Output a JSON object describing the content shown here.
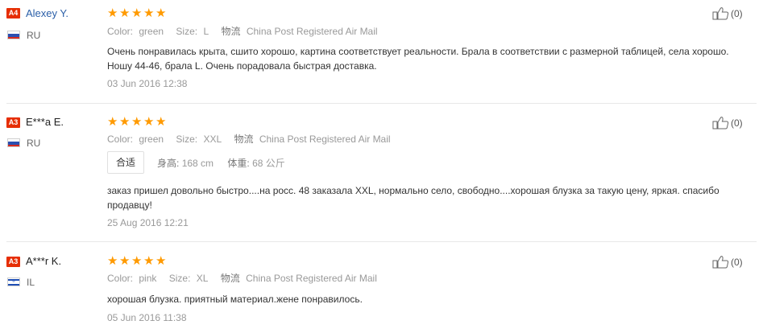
{
  "reviews": [
    {
      "level": "A4",
      "name": "Alexey Y.",
      "country": "RU",
      "stars": 5,
      "meta": {
        "color_label": "Color:",
        "color_value": "green",
        "size_label": "Size:",
        "size_value": "L",
        "ship_label": "物流",
        "ship_value": "China Post Registered Air Mail"
      },
      "text": "Очень понравилась крыта, сшито хорошо, картина соответствует реальности. Брала в соответствии с размерной таблицей, села хорошо. Ношу 44-46, брала L. Очень порадовала быстрая доставка.",
      "date": "03 Jun 2016 12:38",
      "likes": "(0)"
    },
    {
      "level": "A3",
      "name": "E***a E.",
      "country": "RU",
      "stars": 5,
      "meta": {
        "color_label": "Color:",
        "color_value": "green",
        "size_label": "Size:",
        "size_value": "XXL",
        "ship_label": "物流",
        "ship_value": "China Post Registered Air Mail"
      },
      "fit_tag": "合适",
      "height_label": "身高:",
      "height_value": "168 cm",
      "weight_label": "体重:",
      "weight_value": "68 公斤",
      "text": "заказ пришел довольно быстро....на росс. 48 заказала XXL, нормально село, свободно....хорошая блузка за такую цену, яркая. спасибо продавцу!",
      "date": "25 Aug 2016 12:21",
      "likes": "(0)"
    },
    {
      "level": "A3",
      "name": "A***r K.",
      "country": "IL",
      "stars": 5,
      "meta": {
        "color_label": "Color:",
        "color_value": "pink",
        "size_label": "Size:",
        "size_value": "XL",
        "ship_label": "物流",
        "ship_value": "China Post Registered Air Mail"
      },
      "text": "хорошая блузка. приятный материал.жене понравилось.",
      "date": "05 Jun 2016 11:38",
      "likes": "(0)"
    }
  ],
  "colors": {
    "star": "#ff9a00",
    "badge": "#e62e04",
    "name_link": "#2b5fa8"
  },
  "icons": {
    "like": "thumbs-up-icon",
    "star": "star-icon"
  }
}
